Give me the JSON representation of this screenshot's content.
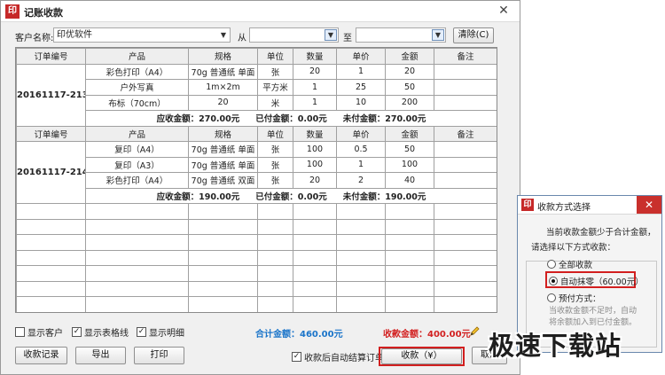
{
  "window": {
    "logo": "印",
    "title": "记账收款",
    "close": "✕"
  },
  "filter": {
    "customer_label": "客户名称:",
    "customer_value": "印优软件",
    "from_label": "从",
    "to_label": "至",
    "clear_button": "清除(C)"
  },
  "columns": [
    "订单编号",
    "产品",
    "规格",
    "单位",
    "数量",
    "单价",
    "金额",
    "备注"
  ],
  "orders": [
    {
      "order_no": "20161117-213",
      "items": [
        {
          "product": "彩色打印（A4）",
          "spec": "70g 普通纸 单面",
          "unit": "张",
          "qty": "20",
          "price": "1",
          "amount": "20",
          "note": ""
        },
        {
          "product": "户外写真",
          "spec": "1m×2m",
          "unit": "平方米",
          "qty": "1",
          "price": "25",
          "amount": "50",
          "note": ""
        },
        {
          "product": "布标（70cm）",
          "spec": "20",
          "unit": "米",
          "qty": "1",
          "price": "10",
          "amount": "200",
          "note": ""
        }
      ],
      "receivable": "应收金额：270.00元",
      "paid": "已付金额：0.00元",
      "unpaid": "未付金额：270.00元"
    },
    {
      "order_no": "20161117-214",
      "items": [
        {
          "product": "复印（A4）",
          "spec": "70g 普通纸 单面",
          "unit": "张",
          "qty": "100",
          "price": "0.5",
          "amount": "50",
          "note": ""
        },
        {
          "product": "复印（A3）",
          "spec": "70g 普通纸 单面",
          "unit": "张",
          "qty": "100",
          "price": "1",
          "amount": "100",
          "note": ""
        },
        {
          "product": "彩色打印（A4）",
          "spec": "70g 普通纸 双面",
          "unit": "张",
          "qty": "20",
          "price": "2",
          "amount": "40",
          "note": ""
        }
      ],
      "receivable": "应收金额：190.00元",
      "paid": "已付金额：0.00元",
      "unpaid": "未付金额：190.00元"
    }
  ],
  "options": {
    "show_customer": "显示客户",
    "show_gridlines": "显示表格线",
    "show_detail": "显示明细",
    "show_customer_checked": false,
    "show_gridlines_checked": true,
    "show_detail_checked": true,
    "check_mark": "✓"
  },
  "totals": {
    "total": "合计金额：460.00元",
    "received": "收款金额：400.00元",
    "total_color": "#1a74c9",
    "received_color": "#d21f1f"
  },
  "buttons": {
    "records": "收款记录",
    "export": "导出",
    "print": "打印",
    "auto_settle": "收款后自动结算订单",
    "auto_settle_checked": true,
    "collect": "收款（¥）",
    "cancel": "取消"
  },
  "dialog": {
    "logo": "印",
    "title": "收款方式选择",
    "close": "✕",
    "message_line1": "当前收款金额少于合计金额，",
    "message_line2": "请选择以下方式收款：",
    "option_full": "全部收款",
    "option_auto": "自动抹零（60.00元）",
    "option_prepay": "预付方式：",
    "hint_line1": "当收款金额不足时，自动",
    "hint_line2": "将余额加入到已付金额。",
    "selected": "auto"
  },
  "watermark": "极速下载站"
}
